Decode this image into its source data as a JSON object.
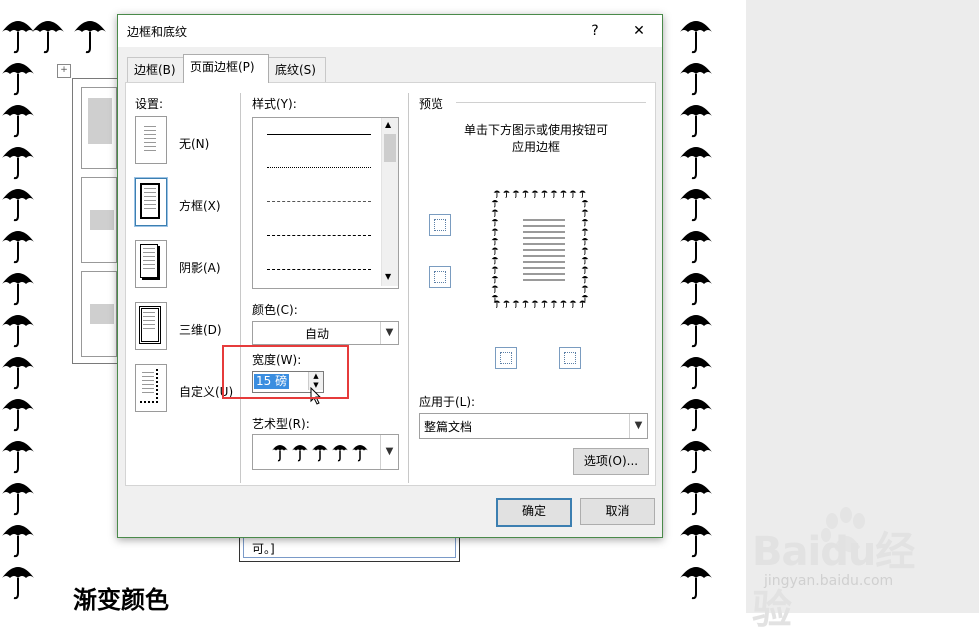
{
  "document": {
    "heading": "渐变颜色",
    "note_text": "可。]"
  },
  "watermark": {
    "brand": "Baidu经验",
    "url": "jingyan.baidu.com"
  },
  "dialog": {
    "title": "边框和底纹",
    "help_label": "?",
    "close_label": "✕",
    "tabs": [
      {
        "label": "边框(B)",
        "active": false
      },
      {
        "label": "页面边框(P)",
        "active": true
      },
      {
        "label": "底纹(S)",
        "active": false
      }
    ],
    "settings": {
      "label": "设置:",
      "items": [
        {
          "label": "无(N)",
          "selected": false
        },
        {
          "label": "方框(X)",
          "selected": true
        },
        {
          "label": "阴影(A)",
          "selected": false
        },
        {
          "label": "三维(D)",
          "selected": false
        },
        {
          "label": "自定义(U)",
          "selected": false
        }
      ]
    },
    "style": {
      "label": "样式(Y):"
    },
    "color": {
      "label": "颜色(C):",
      "value": "自动"
    },
    "width": {
      "label": "宽度(W):",
      "value": "15 磅"
    },
    "art": {
      "label": "艺术型(R):"
    },
    "preview": {
      "label": "预览",
      "hint_line1": "单击下方图示或使用按钮可",
      "hint_line2": "应用边框"
    },
    "apply_to": {
      "label": "应用于(L):",
      "value": "整篇文档"
    },
    "options_label": "选项(O)...",
    "ok_label": "确定",
    "cancel_label": "取消"
  },
  "colors": {
    "highlight_red": "#e63b3b",
    "selection_blue": "#3b8ee0",
    "dialog_border": "#4a8a4a"
  }
}
